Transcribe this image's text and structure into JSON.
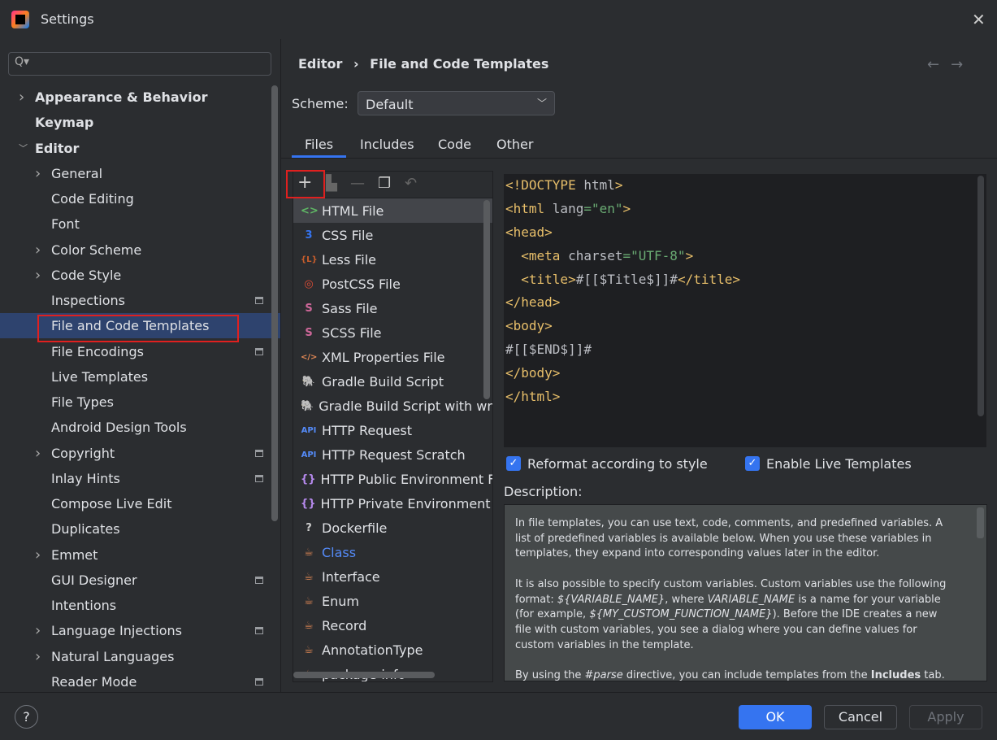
{
  "window": {
    "title": "Settings"
  },
  "search": {
    "placeholder": "Q▾"
  },
  "sidebar": {
    "items": [
      {
        "label": "Appearance & Behavior",
        "level": 0,
        "chevron": true
      },
      {
        "label": "Keymap",
        "level": 0,
        "chevron": false
      },
      {
        "label": "Editor",
        "level": 0,
        "chevron": true,
        "expanded": true
      },
      {
        "label": "General",
        "level": 1,
        "chevron": true
      },
      {
        "label": "Code Editing",
        "level": 1
      },
      {
        "label": "Font",
        "level": 1
      },
      {
        "label": "Color Scheme",
        "level": 1,
        "chevron": true
      },
      {
        "label": "Code Style",
        "level": 1,
        "chevron": true
      },
      {
        "label": "Inspections",
        "level": 1,
        "settings_icon": true
      },
      {
        "label": "File and Code Templates",
        "level": 1,
        "selected": true
      },
      {
        "label": "File Encodings",
        "level": 1,
        "settings_icon": true
      },
      {
        "label": "Live Templates",
        "level": 1
      },
      {
        "label": "File Types",
        "level": 1
      },
      {
        "label": "Android Design Tools",
        "level": 1
      },
      {
        "label": "Copyright",
        "level": 1,
        "chevron": true,
        "settings_icon": true
      },
      {
        "label": "Inlay Hints",
        "level": 1,
        "settings_icon": true
      },
      {
        "label": "Compose Live Edit",
        "level": 1
      },
      {
        "label": "Duplicates",
        "level": 1
      },
      {
        "label": "Emmet",
        "level": 1,
        "chevron": true
      },
      {
        "label": "GUI Designer",
        "level": 1,
        "settings_icon": true
      },
      {
        "label": "Intentions",
        "level": 1
      },
      {
        "label": "Language Injections",
        "level": 1,
        "chevron": true,
        "settings_icon": true
      },
      {
        "label": "Natural Languages",
        "level": 1,
        "chevron": true
      },
      {
        "label": "Reader Mode",
        "level": 1,
        "settings_icon": true
      }
    ]
  },
  "breadcrumb": {
    "parent": "Editor",
    "separator": "›",
    "current": "File and Code Templates"
  },
  "scheme": {
    "label": "Scheme:",
    "value": "Default"
  },
  "tabs": [
    {
      "label": "Files",
      "active": true
    },
    {
      "label": "Includes"
    },
    {
      "label": "Code"
    },
    {
      "label": "Other"
    }
  ],
  "templates": [
    {
      "label": "HTML File",
      "icon": "html-icon",
      "glyph": "<>",
      "color": "#5fb865",
      "selected": true
    },
    {
      "label": "CSS File",
      "icon": "css-icon",
      "glyph": "3",
      "color": "#3574f0"
    },
    {
      "label": "Less File",
      "icon": "less-icon",
      "glyph": "{L}",
      "color": "#c75d2c"
    },
    {
      "label": "PostCSS File",
      "icon": "postcss-icon",
      "glyph": "◎",
      "color": "#dd4c35"
    },
    {
      "label": "Sass File",
      "icon": "sass-icon",
      "glyph": "S",
      "color": "#cd6799"
    },
    {
      "label": "SCSS File",
      "icon": "scss-icon",
      "glyph": "S",
      "color": "#cd6799"
    },
    {
      "label": "XML Properties File",
      "icon": "xml-icon",
      "glyph": "</>",
      "color": "#e08855"
    },
    {
      "label": "Gradle Build Script",
      "icon": "gradle-icon",
      "glyph": "🐘",
      "color": "#aaaaaa"
    },
    {
      "label": "Gradle Build Script with wrapper",
      "icon": "gradle-icon",
      "glyph": "🐘",
      "color": "#aaaaaa"
    },
    {
      "label": "HTTP Request",
      "icon": "api-icon",
      "glyph": "API",
      "color": "#548af7"
    },
    {
      "label": "HTTP Request Scratch",
      "icon": "api-icon",
      "glyph": "API",
      "color": "#548af7"
    },
    {
      "label": "HTTP Public Environment File",
      "icon": "braces-icon",
      "glyph": "{}",
      "color": "#b589ec"
    },
    {
      "label": "HTTP Private Environment File",
      "icon": "braces-icon",
      "glyph": "{}",
      "color": "#b589ec"
    },
    {
      "label": "Dockerfile",
      "icon": "question-icon",
      "glyph": "?",
      "color": "#cccccc"
    },
    {
      "label": "Class",
      "icon": "java-icon",
      "glyph": "☕",
      "color": "#e08855",
      "link": true
    },
    {
      "label": "Interface",
      "icon": "java-icon",
      "glyph": "☕",
      "color": "#e08855"
    },
    {
      "label": "Enum",
      "icon": "java-icon",
      "glyph": "☕",
      "color": "#e08855"
    },
    {
      "label": "Record",
      "icon": "java-icon",
      "glyph": "☕",
      "color": "#e08855"
    },
    {
      "label": "AnnotationType",
      "icon": "java-icon",
      "glyph": "☕",
      "color": "#e08855"
    },
    {
      "label": "package-info",
      "icon": "java-icon",
      "glyph": "☕",
      "color": "#e08855"
    }
  ],
  "code": [
    [
      [
        "t",
        "<!DOCTYPE "
      ],
      [
        "a",
        "html"
      ],
      [
        "t",
        ">"
      ]
    ],
    [
      [
        "t",
        "<html "
      ],
      [
        "a",
        "lang"
      ],
      [
        "s",
        "=\"en\""
      ],
      [
        "t",
        ">"
      ]
    ],
    [
      [
        "t",
        "<head>"
      ]
    ],
    [
      [
        "p",
        "  "
      ],
      [
        "t",
        "<meta "
      ],
      [
        "a",
        "charset"
      ],
      [
        "s",
        "=\"UTF-8\""
      ],
      [
        "t",
        ">"
      ]
    ],
    [
      [
        "p",
        "  "
      ],
      [
        "t",
        "<title>"
      ],
      [
        "p",
        "#[[$Title$]]#"
      ],
      [
        "t",
        "</title>"
      ]
    ],
    [
      [
        "t",
        "</head>"
      ]
    ],
    [
      [
        "t",
        "<body>"
      ]
    ],
    [
      [
        "p",
        "#[[$END$]]#"
      ]
    ],
    [
      [
        "t",
        "</body>"
      ]
    ],
    [
      [
        "t",
        "</html>"
      ]
    ]
  ],
  "options": {
    "reformat": {
      "label": "Reformat according to style",
      "checked": true
    },
    "live_templates": {
      "label": "Enable Live Templates",
      "checked": true
    }
  },
  "description": {
    "label": "Description:",
    "p1": "In file templates, you can use text, code, comments, and predefined variables. A list of predefined variables is available below. When you use these variables in templates, they expand into corresponding values later in the editor.",
    "p2a": "It is also possible to specify custom variables. Custom variables use the following format: ",
    "p2v1": "${VARIABLE_NAME}",
    "p2b": ", where ",
    "p2v2": "VARIABLE_NAME",
    "p2c": " is a name for your variable (for example, ",
    "p2v3": "${MY_CUSTOM_FUNCTION_NAME}",
    "p2d": "). Before the IDE creates a new file with custom variables, you see a dialog where you can define values for custom variables in the template.",
    "p3a": "By using the ",
    "p3v": "#parse",
    "p3b": " directive, you can include templates from the ",
    "p3bold": "Includes",
    "p3c": " tab."
  },
  "footer": {
    "help": "?",
    "ok": "OK",
    "cancel": "Cancel",
    "apply": "Apply"
  },
  "colors": {
    "accent": "#3574f0",
    "selection": "#2e436e",
    "highlight_box": "#e0201f"
  }
}
